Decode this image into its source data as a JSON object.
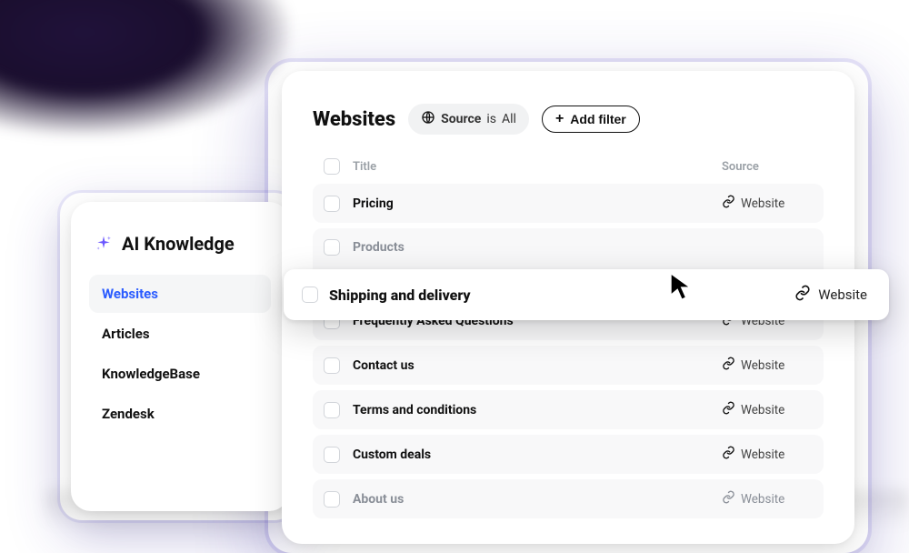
{
  "sidebar": {
    "title": "AI Knowledge",
    "items": [
      {
        "label": "Websites",
        "active": true
      },
      {
        "label": "Articles",
        "active": false
      },
      {
        "label": "KnowledgeBase",
        "active": false
      },
      {
        "label": "Zendesk",
        "active": false
      }
    ]
  },
  "main": {
    "title": "Websites",
    "filter": {
      "field_label": "Source",
      "operator": "is",
      "value": "All"
    },
    "add_filter_label": "Add filter",
    "columns": {
      "title": "Title",
      "source": "Source"
    },
    "rows": [
      {
        "title": "Pricing",
        "source": "Website"
      },
      {
        "title": "Products",
        "source": ""
      },
      {
        "title": "Shipping and delivery",
        "source": "Website"
      },
      {
        "title": "Frequently Asked Questions",
        "source": "Website"
      },
      {
        "title": "Contact us",
        "source": "Website"
      },
      {
        "title": "Terms and conditions",
        "source": "Website"
      },
      {
        "title": "Custom deals",
        "source": "Website"
      },
      {
        "title": "About us",
        "source": "Website"
      }
    ],
    "hover_row_index": 2
  }
}
